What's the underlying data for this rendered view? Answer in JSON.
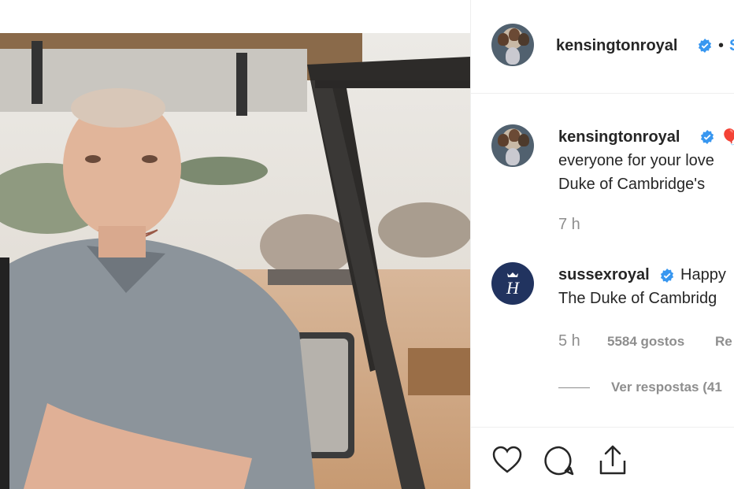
{
  "header": {
    "username": "kensingtonroyal",
    "separator": "•",
    "follow_label": "S",
    "avatar_icon": "family-photo-icon",
    "verified_icon": "verified-badge-icon"
  },
  "comments": [
    {
      "username": "kensingtonroyal",
      "emoji": "🎈",
      "lines": [
        "everyone for your love",
        "Duke of Cambridge's"
      ],
      "time": "7 h",
      "avatar_icon": "family-photo-icon"
    },
    {
      "username": "sussexroyal",
      "text_start": "Happy",
      "lines": [
        "The Duke of Cambridg"
      ],
      "time": "5 h",
      "likes": "5584 gostos",
      "reply_label": "Re",
      "view_replies": "Ver respostas (41",
      "avatar_icon": "sussex-monogram-icon"
    }
  ],
  "actions": {
    "like_icon": "heart-icon",
    "comment_icon": "comment-icon",
    "share_icon": "share-icon"
  },
  "colors": {
    "verified": "#3897f0",
    "text": "#262626",
    "muted": "#8e8e8e",
    "sussex_bg": "#21335f"
  }
}
